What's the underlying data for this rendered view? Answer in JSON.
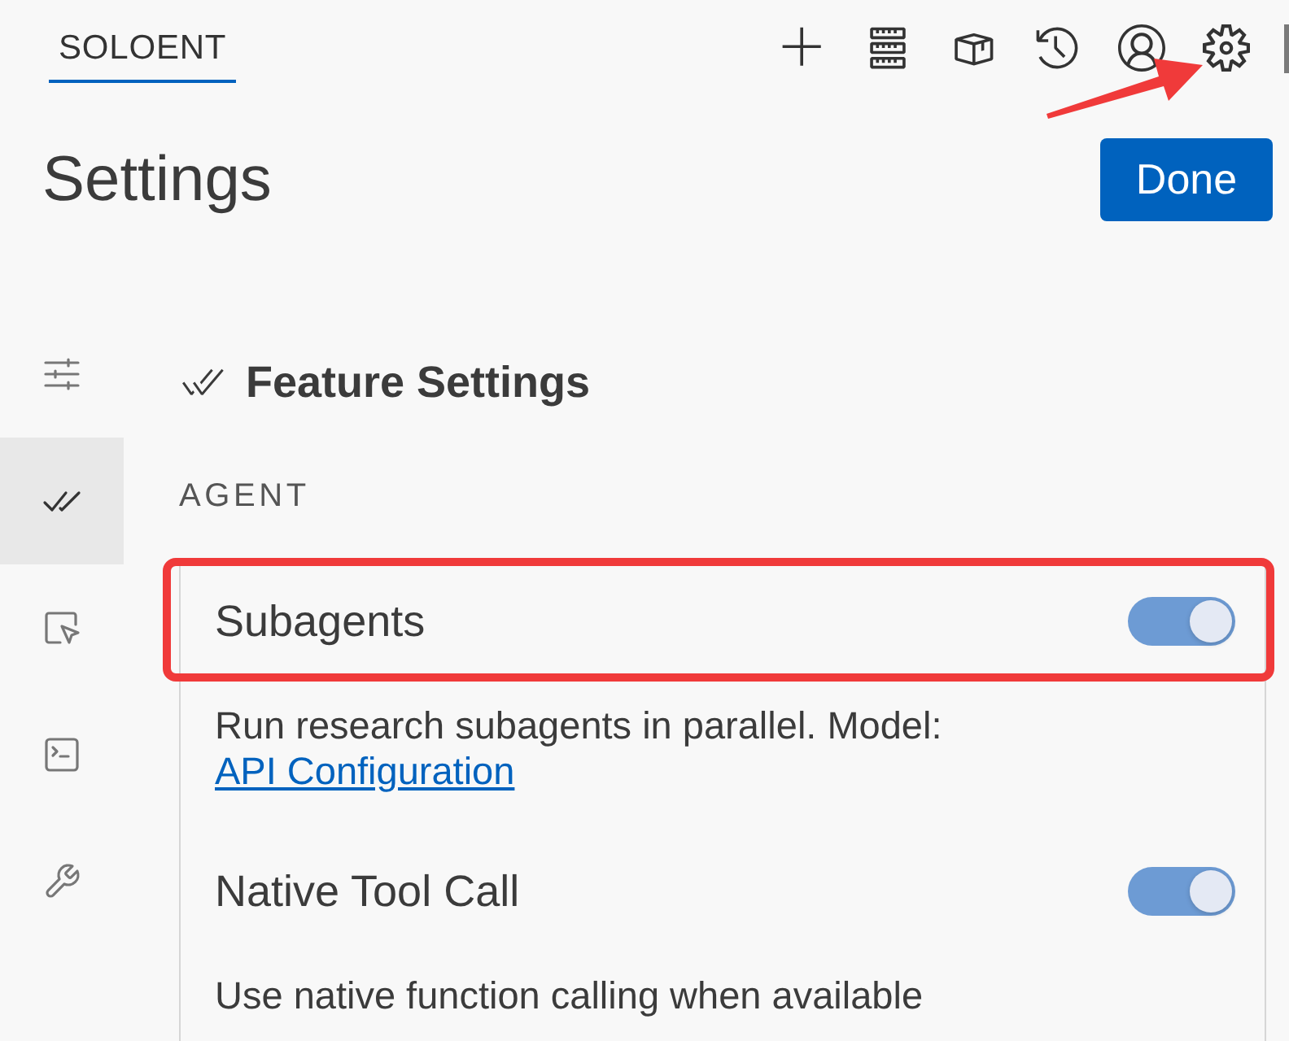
{
  "tabs": [
    {
      "label": "SOLOENT",
      "selected": true
    }
  ],
  "toolbar": [
    {
      "kind": "plus",
      "highlighted": false
    },
    {
      "kind": "server",
      "highlighted": false
    },
    {
      "kind": "box",
      "highlighted": false
    },
    {
      "kind": "history",
      "highlighted": false
    },
    {
      "kind": "account",
      "highlighted": false
    },
    {
      "kind": "gear",
      "highlighted": true
    }
  ],
  "title": "Settings",
  "done_button": {
    "label": "Done"
  },
  "sidebar": [
    {
      "kind": "sliders",
      "selected": false
    },
    {
      "kind": "checks",
      "selected": true
    },
    {
      "kind": "cursor",
      "selected": false
    },
    {
      "kind": "terminal",
      "selected": false
    },
    {
      "kind": "wrench",
      "selected": false
    }
  ],
  "panel": {
    "heading": "Feature Settings",
    "group": "AGENT",
    "settings": [
      {
        "label": "Subagents",
        "on": true,
        "highlighted": true,
        "description": "Run research subagents in parallel. Model:",
        "link": "API Configuration"
      },
      {
        "label": "Native Tool Call",
        "on": true,
        "highlighted": false,
        "description": "Use native function calling when available"
      }
    ]
  }
}
